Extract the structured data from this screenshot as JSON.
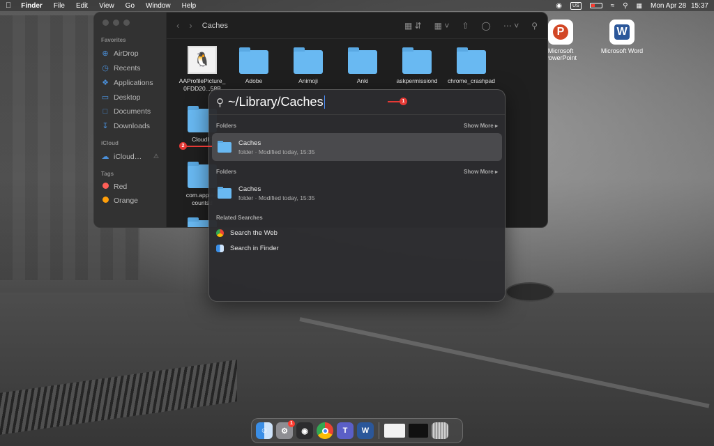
{
  "menubar": {
    "app_name": "Finder",
    "items": [
      "File",
      "Edit",
      "View",
      "Go",
      "Window",
      "Help"
    ],
    "keyboard_layout": "US",
    "date": "Mon Apr 28",
    "time": "15:37",
    "icons": [
      "apple-icon",
      "chrome-icon",
      "keyboard-layout-icon",
      "battery-icon",
      "wifi-icon",
      "spotlight-icon",
      "control-center-icon"
    ]
  },
  "desktop": {
    "icons": [
      {
        "label_line1": "Microsoft",
        "label_line2": "PowerPoint",
        "glyph": "P",
        "color": "#d24726"
      },
      {
        "label": "Microsoft Word",
        "glyph": "W",
        "color": "#2b579a"
      }
    ]
  },
  "finder": {
    "title": "Caches",
    "sidebar": {
      "favorites_label": "Favorites",
      "favorites": [
        "AirDrop",
        "Recents",
        "Applications",
        "Desktop",
        "Documents",
        "Downloads"
      ],
      "icloud_label": "iCloud",
      "icloud_item": "iCloud…",
      "tags_label": "Tags",
      "tags": [
        {
          "label": "Red",
          "color": "#ff5f57"
        },
        {
          "label": "Orange",
          "color": "#ff9f0a"
        }
      ]
    },
    "files": [
      {
        "line1": "AAProfilePicture_",
        "line2": "0FDD20...58B",
        "type": "image"
      },
      {
        "line1": "Adobe",
        "line2": "",
        "type": "folder"
      },
      {
        "line1": "Animoji",
        "line2": "",
        "type": "folder"
      },
      {
        "line1": "Anki",
        "line2": "",
        "type": "folder"
      },
      {
        "line1": "askpermissiond",
        "line2": "",
        "type": "folder"
      },
      {
        "line1": "chrome_crashpad",
        "line2": "",
        "type": "folder"
      },
      {
        "line1": "CloudKi",
        "line2": "",
        "type": "folder"
      },
      {
        "line1": "com.apple.a",
        "line2": "countsd",
        "type": "folder"
      }
    ]
  },
  "spotlight": {
    "query": "~/Library/Caches",
    "sections": [
      {
        "label": "Folders",
        "show_more": "Show More",
        "result": {
          "name": "Caches",
          "sub": "folder · Modified today, 15:35",
          "selected": true
        }
      },
      {
        "label": "Folders",
        "show_more": "Show More",
        "result": {
          "name": "Caches",
          "sub": "folder · Modified today, 15:35",
          "selected": false
        }
      }
    ],
    "related_label": "Related Searches",
    "related": [
      {
        "label": "Search the Web",
        "icon": "chrome-icon"
      },
      {
        "label": "Search in Finder",
        "icon": "finder-icon"
      }
    ]
  },
  "annotations": [
    "1",
    "2"
  ],
  "dock": {
    "apps": [
      "Finder",
      "System Settings",
      "Screenshot",
      "Google Chrome",
      "Microsoft Teams",
      "Microsoft Word"
    ],
    "settings_badge": "1"
  }
}
